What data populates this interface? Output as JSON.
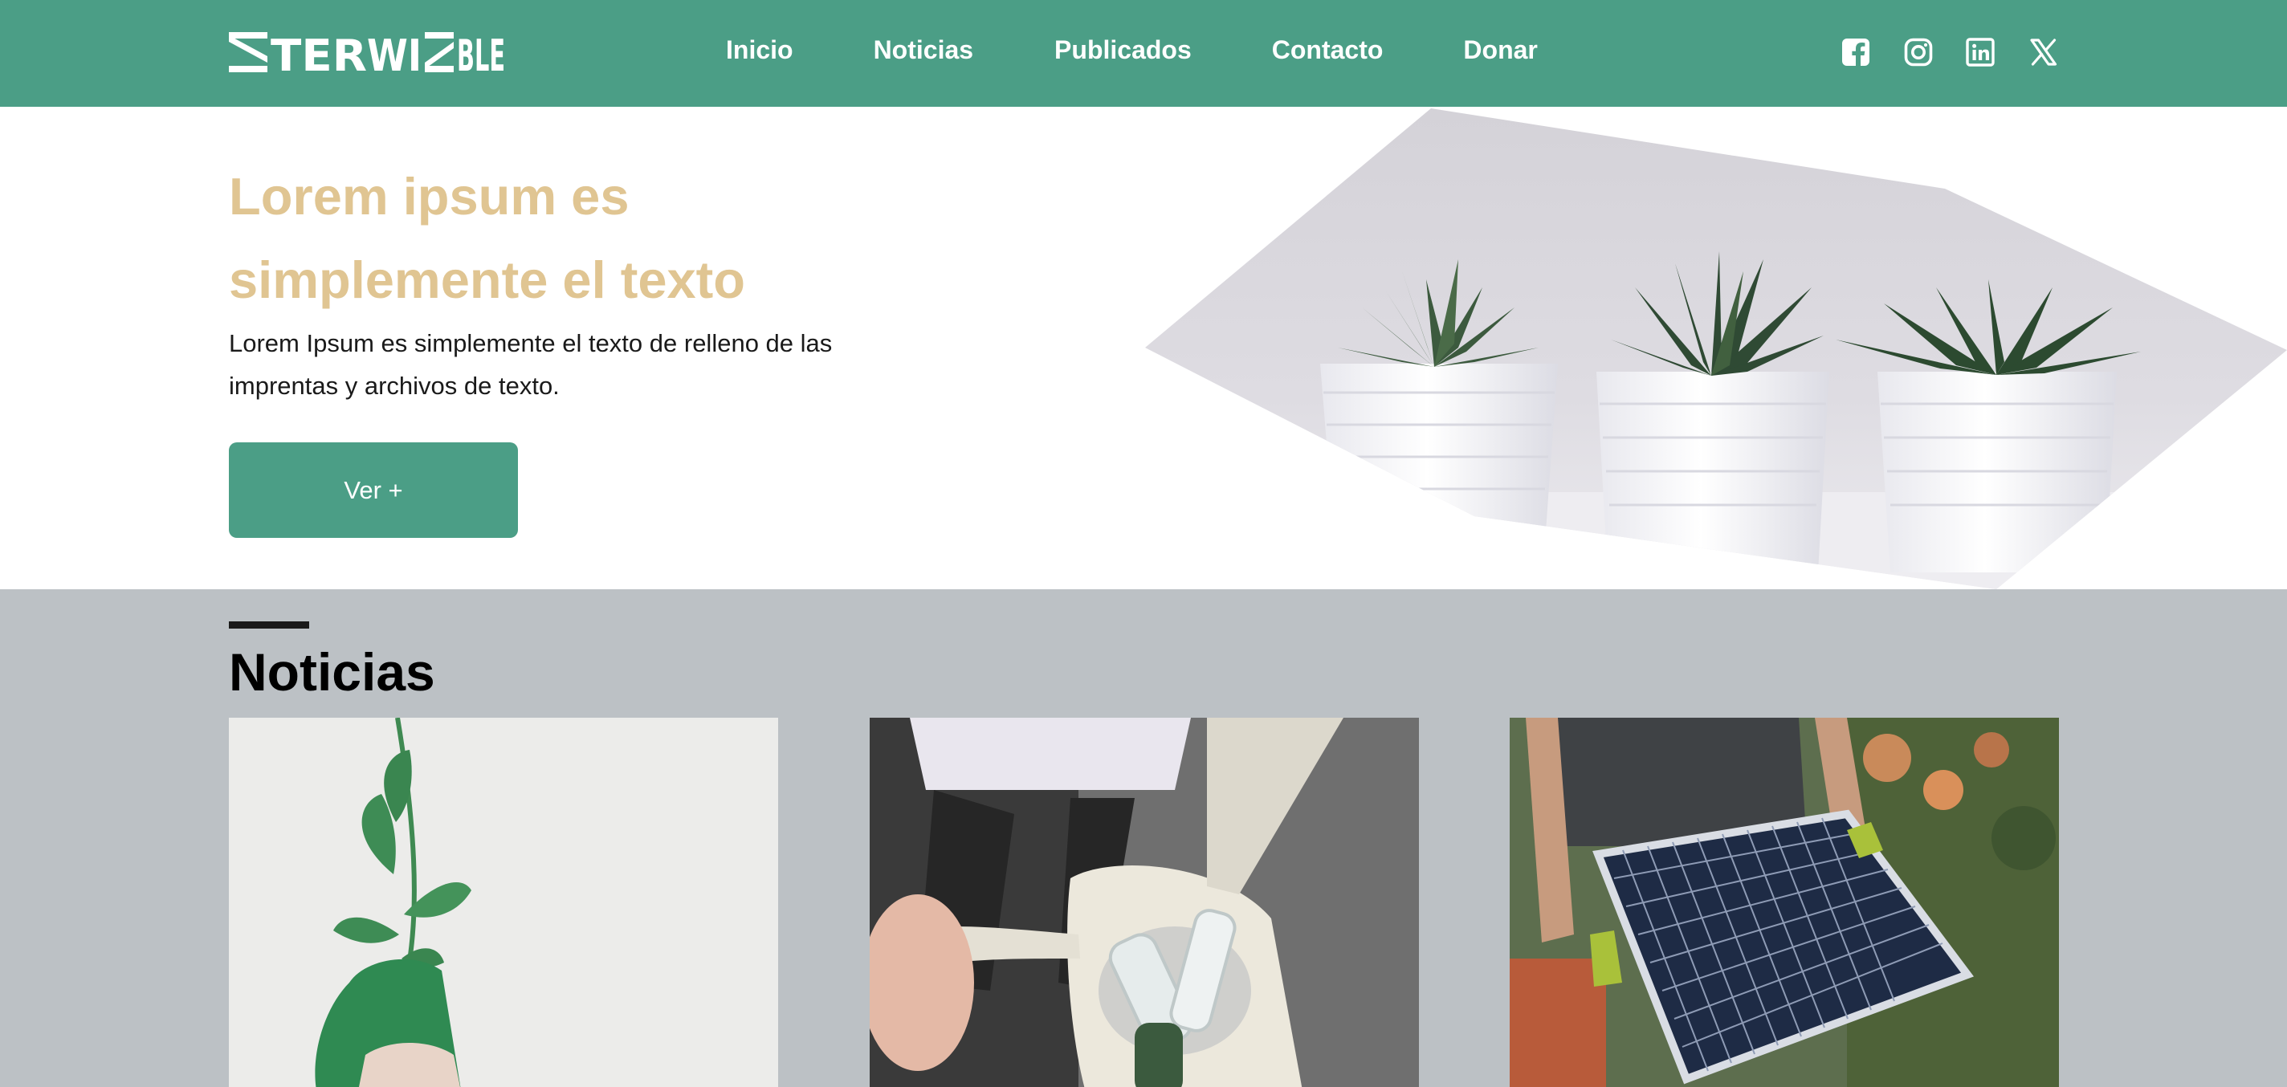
{
  "brand": {
    "name": "INTERWINABLE",
    "logo_label": "ꟷ TERWI ꟷ BLE"
  },
  "nav": {
    "items": [
      {
        "label": "Inicio"
      },
      {
        "label": "Noticias"
      },
      {
        "label": "Publicados"
      },
      {
        "label": "Contacto"
      },
      {
        "label": "Donar"
      }
    ]
  },
  "social": {
    "icons": [
      "facebook-icon",
      "instagram-icon",
      "linkedin-icon",
      "x-icon"
    ]
  },
  "hero": {
    "title": "Lorem ipsum es simplemente el texto",
    "body": "Lorem Ipsum es simplemente el texto de relleno de las imprentas y archivos de texto.",
    "button_label": "Ver +"
  },
  "news": {
    "heading": "Noticias"
  },
  "colors": {
    "brand_green": "#4b9e86",
    "title_gold": "#e0c592",
    "section_gray": "#bcc1c5"
  }
}
